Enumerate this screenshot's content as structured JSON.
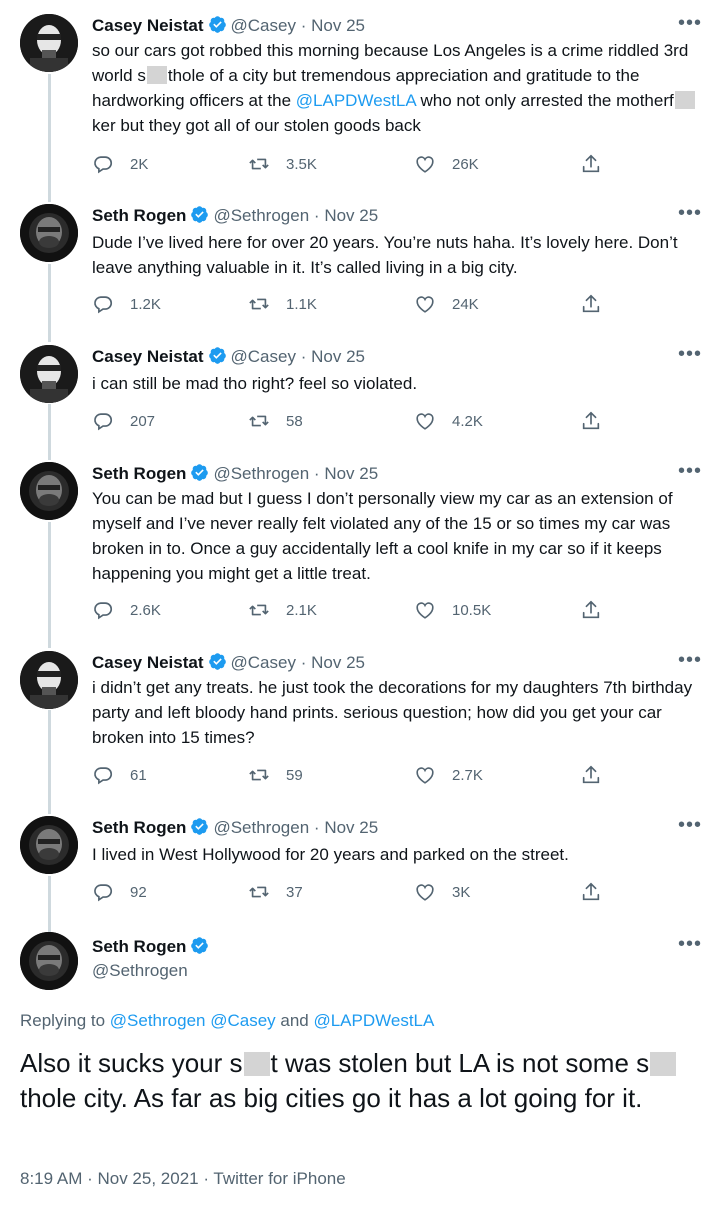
{
  "tweets": [
    {
      "name": "Casey Neistat",
      "handle": "@Casey",
      "date": "Nov 25",
      "more": "•••",
      "text_parts": [
        "so our cars got robbed this morning because Los Angeles is a crime riddled 3rd world s",
        "thole of a city but tremendous appreciation and gratitude to the hardworking officers at the ",
        "@LAPDWestLA",
        " who not only arrested the motherf",
        "ker but they got all of our stolen goods back"
      ],
      "replies": "2K",
      "retweets": "3.5K",
      "likes": "26K"
    },
    {
      "name": "Seth Rogen",
      "handle": "@Sethrogen",
      "date": "Nov 25",
      "more": "•••",
      "text": "Dude I’ve lived here for over 20 years. You’re nuts haha. It’s lovely here. Don’t leave anything valuable in it. It’s called living in a big city.",
      "replies": "1.2K",
      "retweets": "1.1K",
      "likes": "24K"
    },
    {
      "name": "Casey Neistat",
      "handle": "@Casey",
      "date": "Nov 25",
      "more": "•••",
      "text": "i can still be mad tho right?  feel so violated.",
      "replies": "207",
      "retweets": "58",
      "likes": "4.2K"
    },
    {
      "name": "Seth Rogen",
      "handle": "@Sethrogen",
      "date": "Nov 25",
      "more": "•••",
      "text": "You can be mad but I guess I don’t personally view my car as an extension of myself and I’ve never really felt violated any of the 15 or so times my car was broken in to. Once a guy accidentally left a cool knife in my car so if it keeps happening you might get a little treat.",
      "replies": "2.6K",
      "retweets": "2.1K",
      "likes": "10.5K"
    },
    {
      "name": "Casey Neistat",
      "handle": "@Casey",
      "date": "Nov 25",
      "more": "•••",
      "text": "i didn’t get any treats. he just took the decorations for my daughters 7th birthday party and left bloody hand prints.  serious question; how did you get your car broken into 15 times?",
      "replies": "61",
      "retweets": "59",
      "likes": "2.7K"
    },
    {
      "name": "Seth Rogen",
      "handle": "@Sethrogen",
      "date": "Nov 25",
      "more": "•••",
      "text": "I lived in West Hollywood for 20 years and parked on the street.",
      "replies": "92",
      "retweets": "37",
      "likes": "3K"
    }
  ],
  "main": {
    "name": "Seth Rogen",
    "handle": "@Sethrogen",
    "more": "•••",
    "replying_prefix": "Replying to ",
    "replying_mentions": "@Sethrogen @Casey",
    "replying_and": " and ",
    "replying_last": "@LAPDWestLA",
    "text_parts": [
      "Also it sucks your s",
      "t was stolen but LA is not some s",
      "thole city. As far as big cities go it has a lot going for it."
    ],
    "timestamp": "8:19 AM · Nov 25, 2021 · Twitter for iPhone"
  },
  "separator": "·",
  "colors": {
    "accent": "#1d9bf0",
    "muted": "#536471",
    "text": "#0f1419"
  },
  "icons": {
    "reply": "reply-icon",
    "retweet": "retweet-icon",
    "like": "heart-icon",
    "share": "share-icon",
    "verified": "verified-badge-icon"
  }
}
